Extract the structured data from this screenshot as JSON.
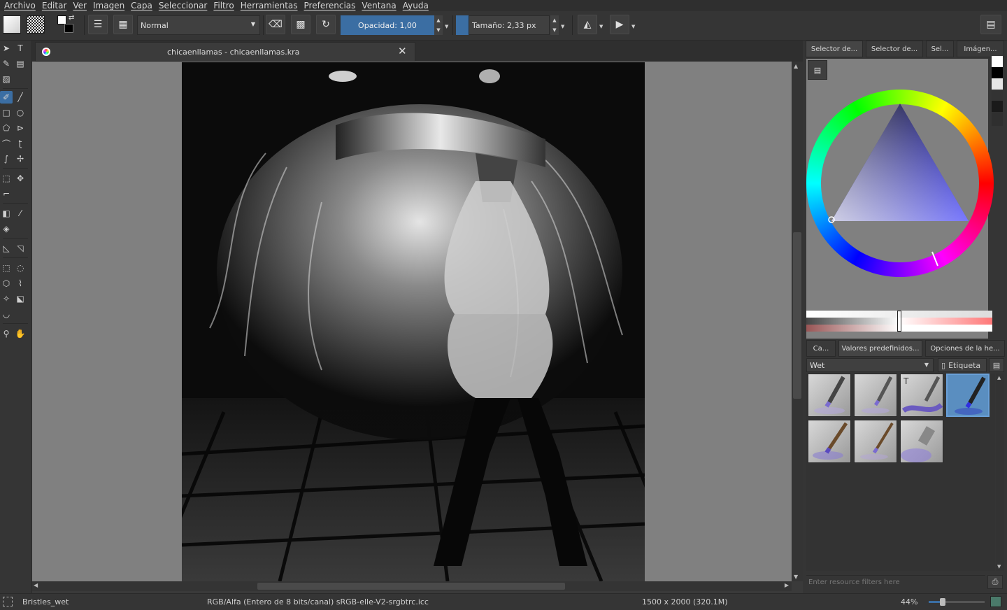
{
  "menubar": [
    "Archivo",
    "Editar",
    "Ver",
    "Imagen",
    "Capa",
    "Seleccionar",
    "Filtro",
    "Herramientas",
    "Preferencias",
    "Ventana",
    "Ayuda"
  ],
  "toolbar": {
    "blend_mode": "Normal",
    "opacity_label": "Opacidad:  1,00",
    "size_label": "Tamaño:  2,33 px"
  },
  "document": {
    "tab_title": "chicaenllamas - chicaenllamas.kra"
  },
  "dockers": {
    "top_tabs": [
      "Selector de...",
      "Selector de...",
      "Sel...",
      "Imágen..."
    ],
    "bottom_tabs": [
      "Ca...",
      "Valores predefinidos...",
      "Opciones de la he..."
    ],
    "preset_filter": "Wet",
    "tag_label": "Etiqueta",
    "resource_filter_placeholder": "Enter resource filters here"
  },
  "statusbar": {
    "brush_name": "Bristles_wet",
    "color_profile": "RGB/Alfa (Entero de 8 bits/canal)  sRGB-elle-V2-srgbtrc.icc",
    "dimensions": "1500 x 2000 (320.1M)",
    "zoom": "44%"
  },
  "colors": {
    "accent": "#3b6ea3",
    "canvas_bg": "#808080",
    "ui_bg": "#353535"
  }
}
